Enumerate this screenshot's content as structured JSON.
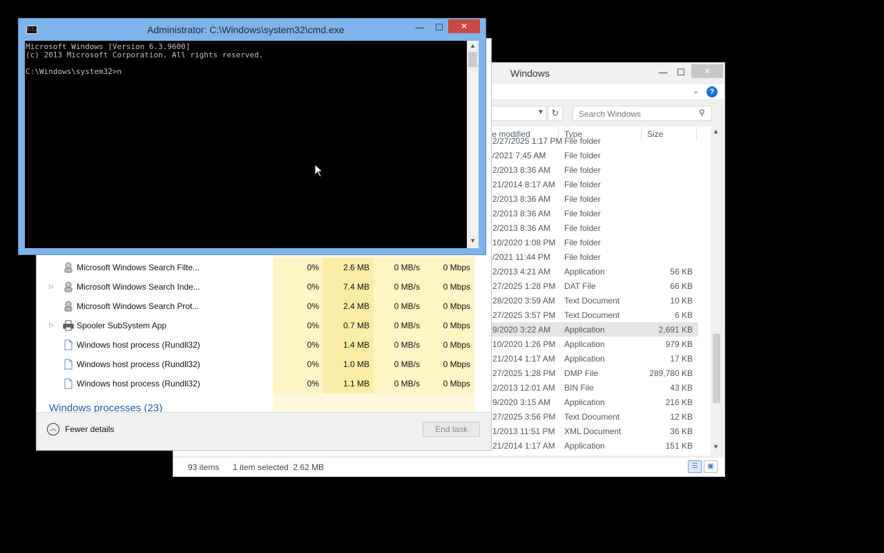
{
  "explorer": {
    "title": "Windows",
    "search_placeholder": "Search Windows",
    "columns": {
      "date": "te modified",
      "type": "Type",
      "size": "Size"
    },
    "rows": [
      {
        "date": "2/27/2025 1:17 PM",
        "type": "File folder",
        "size": ""
      },
      {
        "date": "/2021 7:45 AM",
        "type": "File folder",
        "size": ""
      },
      {
        "date": "2/2013 8:36 AM",
        "type": "File folder",
        "size": ""
      },
      {
        "date": "21/2014 8:17 AM",
        "type": "File folder",
        "size": ""
      },
      {
        "date": "2/2013 8:36 AM",
        "type": "File folder",
        "size": ""
      },
      {
        "date": "2/2013 8:36 AM",
        "type": "File folder",
        "size": ""
      },
      {
        "date": "2/2013 8:36 AM",
        "type": "File folder",
        "size": ""
      },
      {
        "date": "10/2020 1:08 PM",
        "type": "File folder",
        "size": ""
      },
      {
        "date": "/2021 11:44 PM",
        "type": "File folder",
        "size": ""
      },
      {
        "date": "2/2013 4:21 AM",
        "type": "Application",
        "size": "56 KB"
      },
      {
        "date": "27/2025 1:28 PM",
        "type": "DAT File",
        "size": "66 KB"
      },
      {
        "date": "28/2020 3:59 AM",
        "type": "Text Document",
        "size": "10 KB"
      },
      {
        "date": "27/2025 3:57 PM",
        "type": "Text Document",
        "size": "6 KB"
      },
      {
        "date": "9/2020 3:22 AM",
        "type": "Application",
        "size": "2,691 KB"
      },
      {
        "date": "10/2020 1:26 PM",
        "type": "Application",
        "size": "979 KB"
      },
      {
        "date": "21/2014 1:17 AM",
        "type": "Application",
        "size": "17 KB"
      },
      {
        "date": "27/2025 1:28 PM",
        "type": "DMP File",
        "size": "289,780 KB"
      },
      {
        "date": "2/2013 12:01 AM",
        "type": "BIN File",
        "size": "43 KB"
      },
      {
        "date": "9/2020 3:15 AM",
        "type": "Application",
        "size": "216 KB"
      },
      {
        "date": "27/2025 3:56 PM",
        "type": "Text Document",
        "size": "12 KB"
      },
      {
        "date": "1/2013 11:51 PM",
        "type": "XML Document",
        "size": "36 KB"
      },
      {
        "date": "21/2014 1:17 AM",
        "type": "Application",
        "size": "151 KB"
      }
    ],
    "selected_row": 13,
    "status_count": "93 items",
    "status_selected": "1 item selected  2.62 MB"
  },
  "taskmgr": {
    "rows": [
      {
        "name": "Microsoft Windows Search Filte...",
        "expandable": false,
        "icon": "search-service-icon",
        "cpu": "0%",
        "mem": "2.6 MB",
        "disk": "0 MB/s",
        "net": "0 Mbps"
      },
      {
        "name": "Microsoft Windows Search Inde...",
        "expandable": true,
        "icon": "search-service-icon",
        "cpu": "0%",
        "mem": "7.4 MB",
        "disk": "0 MB/s",
        "net": "0 Mbps"
      },
      {
        "name": "Microsoft Windows Search Prot...",
        "expandable": false,
        "icon": "search-service-icon",
        "cpu": "0%",
        "mem": "2.4 MB",
        "disk": "0 MB/s",
        "net": "0 Mbps"
      },
      {
        "name": "Spooler SubSystem App",
        "expandable": true,
        "icon": "printer-icon",
        "cpu": "0%",
        "mem": "0.7 MB",
        "disk": "0 MB/s",
        "net": "0 Mbps"
      },
      {
        "name": "Windows host process (Rundll32)",
        "expandable": false,
        "icon": "document-icon",
        "cpu": "0%",
        "mem": "1.4 MB",
        "disk": "0 MB/s",
        "net": "0 Mbps"
      },
      {
        "name": "Windows host process (Rundll32)",
        "expandable": false,
        "icon": "document-icon",
        "cpu": "0%",
        "mem": "1.0 MB",
        "disk": "0 MB/s",
        "net": "0 Mbps"
      },
      {
        "name": "Windows host process (Rundll32)",
        "expandable": false,
        "icon": "document-icon",
        "cpu": "0%",
        "mem": "1.1 MB",
        "disk": "0 MB/s",
        "net": "0 Mbps"
      }
    ],
    "group_label": "Windows processes (23)",
    "fewer_details": "Fewer details",
    "end_task": "End task"
  },
  "cmd": {
    "title": "Administrator: C:\\Windows\\system32\\cmd.exe",
    "icon_label": "C:\\.",
    "lines": [
      "Microsoft Windows [Version 6.3.9600]",
      "(c) 2013 Microsoft Corporation. All rights reserved.",
      "",
      "C:\\Windows\\system32>n"
    ]
  },
  "window_controls": {
    "minimize": "—",
    "maximize": "☐",
    "close": "✕"
  },
  "colors": {
    "cmd_frame": "#7eb4ea",
    "close_red": "#c74a41",
    "taskmgr_cell": "#fff4c4",
    "link_blue": "#1e5bb1"
  }
}
